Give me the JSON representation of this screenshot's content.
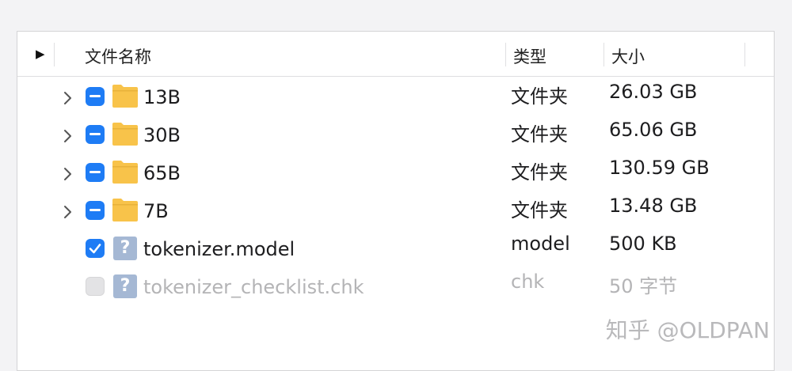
{
  "header": {
    "col_name": "文件名称",
    "col_type": "类型",
    "col_size": "大小"
  },
  "rows": [
    {
      "name": "13B",
      "type": "文件夹",
      "size": "26.03 GB"
    },
    {
      "name": "30B",
      "type": "文件夹",
      "size": "65.06 GB"
    },
    {
      "name": "65B",
      "type": "文件夹",
      "size": "130.59 GB"
    },
    {
      "name": "7B",
      "type": "文件夹",
      "size": "13.48 GB"
    },
    {
      "name": "tokenizer.model",
      "type": "model",
      "size": "500 KB"
    },
    {
      "name": "tokenizer_checklist.chk",
      "type": "chk",
      "size": "50 字节"
    }
  ],
  "watermark": "知乎 @OLDPAN",
  "colors": {
    "accent": "#1e7cf5",
    "folder": "#f8c34a",
    "muted_text": "#b4b4b6"
  }
}
